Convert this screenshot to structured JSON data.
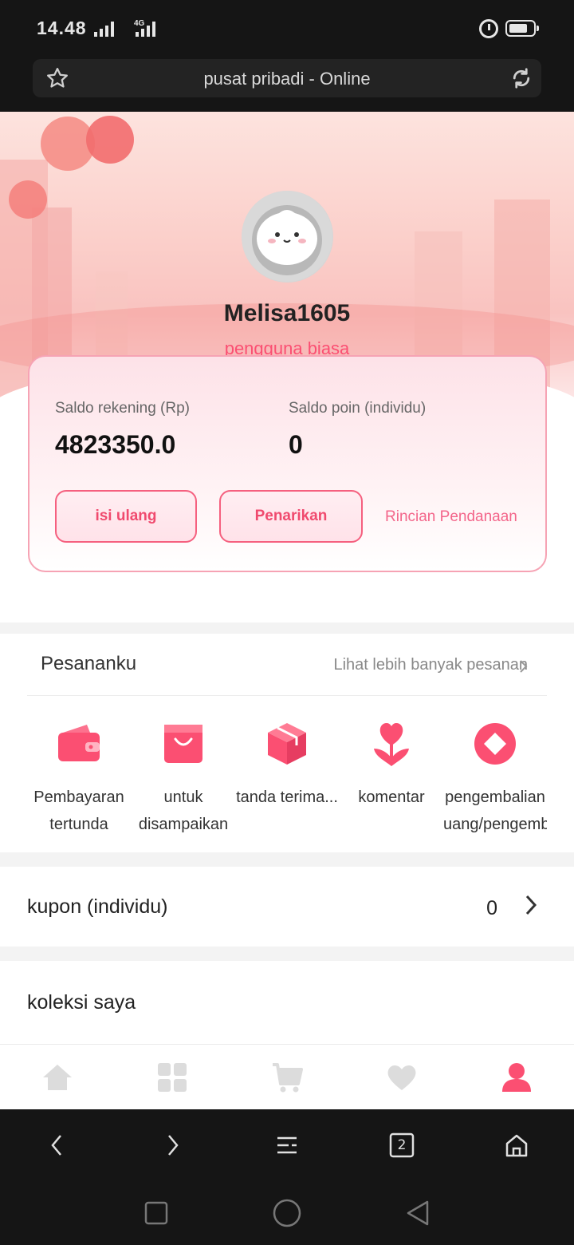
{
  "status_bar": {
    "time": "14.48",
    "network": "4G"
  },
  "browser": {
    "title": "pusat pribadi - Online"
  },
  "profile": {
    "username": "Melisa1605",
    "user_type": "pengguna biasa"
  },
  "balance": {
    "account_label": "Saldo rekening (Rp)",
    "account_value": "4823350.0",
    "points_label": "Saldo poin (individu)",
    "points_value": "0",
    "topup_button": "isi ulang",
    "withdraw_button": "Penarikan",
    "details_link": "Rincian Pendanaan"
  },
  "orders": {
    "title": "Pesananku",
    "more_link": "Lihat lebih banyak pesanan",
    "items": [
      {
        "label": "Pembayaran tertunda",
        "icon": "wallet-icon"
      },
      {
        "label": "untuk disampaikan",
        "icon": "shopping-bag-icon"
      },
      {
        "label": "tanda terima...",
        "icon": "package-box-icon"
      },
      {
        "label": "komentar",
        "icon": "heart-flower-icon"
      },
      {
        "label": "pengembalian uang/pengembalian",
        "icon": "refund-diamond-icon"
      }
    ]
  },
  "coupon": {
    "label": "kupon (individu)",
    "count": "0"
  },
  "collection": {
    "label": "koleksi saya"
  },
  "tab_bar": {
    "items": [
      {
        "icon": "home-icon",
        "active": false
      },
      {
        "icon": "grid-icon",
        "active": false
      },
      {
        "icon": "cart-icon",
        "active": false
      },
      {
        "icon": "heart-icon",
        "active": false
      },
      {
        "icon": "user-icon",
        "active": true
      }
    ]
  },
  "browser_nav": {
    "tab_count": "2"
  },
  "colors": {
    "accent": "#fb4f72",
    "dark": "#151515",
    "card_border": "#f6a3b4"
  }
}
